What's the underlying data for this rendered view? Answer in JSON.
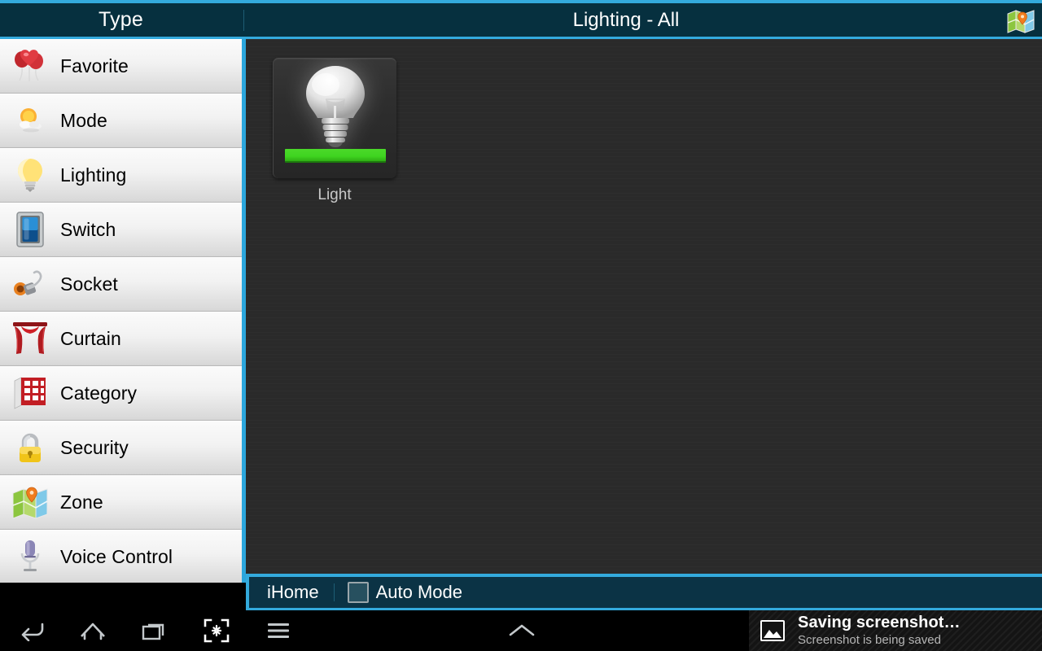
{
  "header": {
    "type_label": "Type",
    "title": "Lighting - All",
    "map_icon": "map-icon"
  },
  "sidebar": {
    "items": [
      {
        "label": "Favorite",
        "icon": "balloons-icon"
      },
      {
        "label": "Mode",
        "icon": "sun-cloud-icon"
      },
      {
        "label": "Lighting",
        "icon": "lightbulb-icon"
      },
      {
        "label": "Switch",
        "icon": "switch-icon"
      },
      {
        "label": "Socket",
        "icon": "socket-plug-icon"
      },
      {
        "label": "Curtain",
        "icon": "curtain-icon"
      },
      {
        "label": "Category",
        "icon": "category-grid-icon"
      },
      {
        "label": "Security",
        "icon": "padlock-icon"
      },
      {
        "label": "Zone",
        "icon": "map-pin-icon"
      },
      {
        "label": "Voice Control",
        "icon": "microphone-icon"
      }
    ]
  },
  "main": {
    "tiles": [
      {
        "label": "Light",
        "icon": "lightbulb-icon",
        "status": "on",
        "status_color": "#3fd420"
      }
    ]
  },
  "bottom_bar": {
    "app_name": "iHome",
    "auto_mode_label": "Auto Mode",
    "auto_mode_checked": false
  },
  "navigation": {
    "buttons": [
      {
        "name": "back-icon"
      },
      {
        "name": "home-icon"
      },
      {
        "name": "recents-icon"
      },
      {
        "name": "screenshot-icon"
      },
      {
        "name": "menu-icon"
      }
    ],
    "expand_icon": "chevron-up-icon"
  },
  "toast": {
    "icon": "image-icon",
    "title": "Saving screenshot…",
    "subtitle": "Screenshot is being saved"
  },
  "colors": {
    "accent_cyan": "#33aadd",
    "header_navy": "#06303f",
    "content_dark": "#2a2a2a",
    "status_green": "#3fd420"
  }
}
